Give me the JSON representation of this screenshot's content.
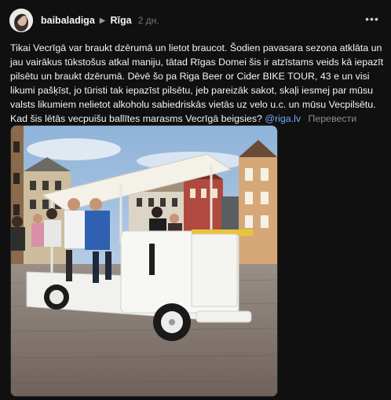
{
  "post": {
    "username": "baibaladiga",
    "topic": "Rīga",
    "time": "2 дн.",
    "body_text": "Tikai Vecrīgā var braukt dzērumā un lietot braucot. Šodien pavasara sezona atklāta un jau vairākus tūkstošus atkal maniju, tātad Rīgas Domei šis ir atzīstams veids kā iepazīt pilsētu un braukt dzērumā. Dēvē šo pa Riga Beer or Cider BIKE TOUR, 43 e un visi likumi pašķīst, jo tūristi tak iepazīst pilsētu, jeb pareizāk sakot, skaļi iesmej par mūsu valsts likumiem nelietot alkoholu sabiedriskās vietās uz velo u.c. un mūsu Vecpilsētu. Kad šis lētās vecpuišu ballītes marasms Vecrīgā beigsies?",
    "mention": "@riga.lv",
    "translate_label": "Перевести"
  },
  "icons": {
    "more": "more-dots-icon",
    "chevron": "chevron-right-icon"
  },
  "colors": {
    "background": "#101010",
    "text": "#f3f5f7",
    "mention": "#6ea8ff",
    "muted": "#8e8e8e"
  }
}
